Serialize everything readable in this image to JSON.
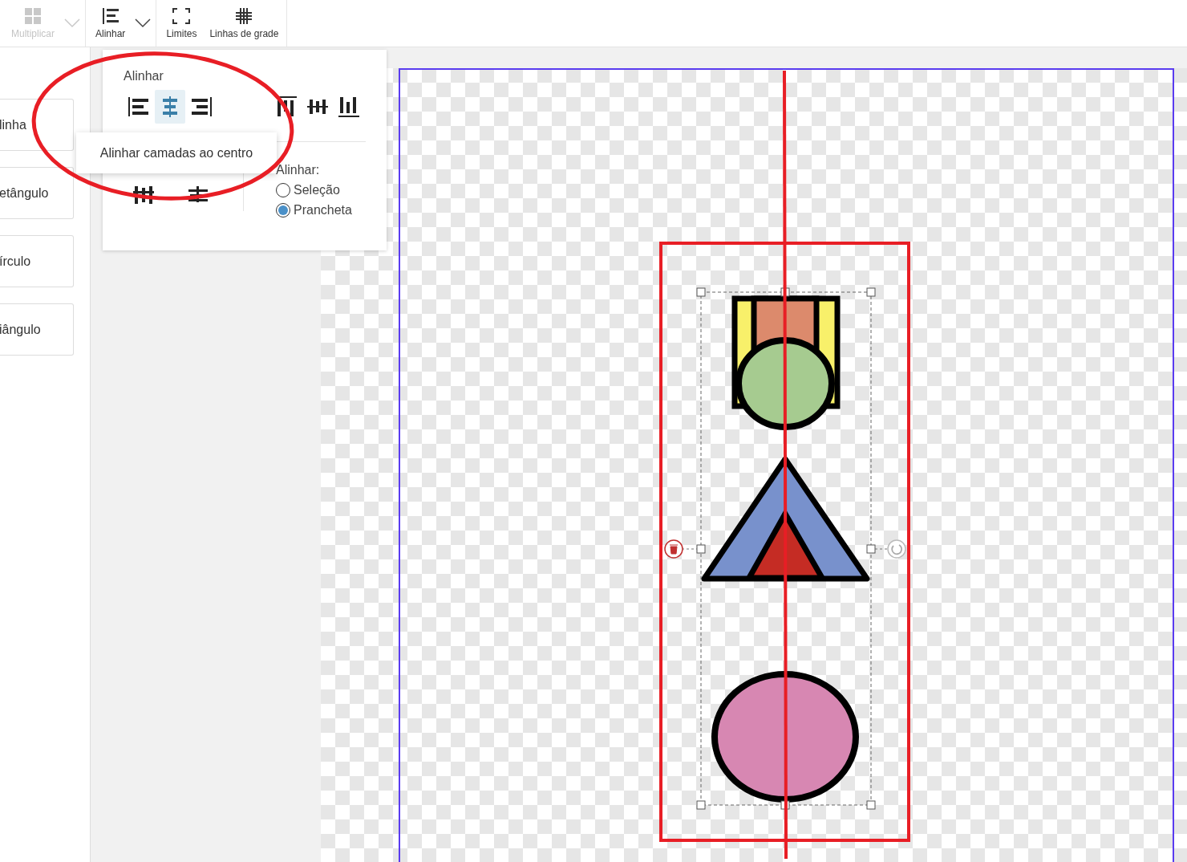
{
  "toolbar": [
    {
      "label": "Multiplicar",
      "kind": "grid",
      "disabled": true,
      "dropdown": true
    },
    {
      "label": "Alinhar",
      "kind": "align",
      "disabled": false,
      "dropdown": true
    },
    {
      "label": "Limites",
      "kind": "bounds",
      "disabled": false,
      "dropdown": false
    },
    {
      "label": "Linhas de grade",
      "kind": "gridlines",
      "disabled": false,
      "dropdown": false
    }
  ],
  "shape_buttons": [
    "linha",
    "etângulo",
    "írculo",
    "iângulo"
  ],
  "align_popover": {
    "title": "Alinhar",
    "align_buttons": [
      {
        "kind": "left",
        "selected": false
      },
      {
        "kind": "hcenter",
        "selected": true
      },
      {
        "kind": "right",
        "selected": false
      },
      {
        "kind": "top",
        "selected": false
      },
      {
        "kind": "vcenter",
        "selected": false
      },
      {
        "kind": "bottom",
        "selected": false
      }
    ],
    "distribute_buttons": [
      {
        "kind": "hspace"
      },
      {
        "kind": "vspace"
      }
    ],
    "align_to": {
      "label": "Alinhar:",
      "options": [
        {
          "label": "Seleção",
          "selected": false
        },
        {
          "label": "Prancheta",
          "selected": true
        }
      ]
    }
  },
  "tooltip": "Alinhar camadas ao centro"
}
